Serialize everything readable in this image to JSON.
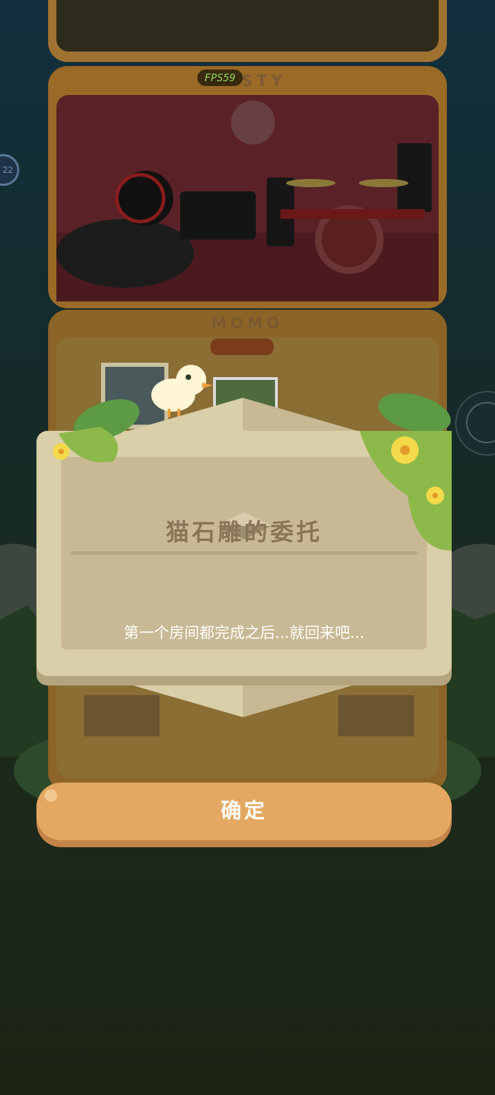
{
  "hud": {
    "fps_label": "FPS59",
    "left_badge": "22"
  },
  "rooms": [
    {
      "name": "DUSTY"
    },
    {
      "name": "MOMO"
    }
  ],
  "dialog": {
    "title": "猫石雕的委托",
    "message": "第一个房间都完成之后...就回来吧...",
    "confirm_label": "确定"
  },
  "colors": {
    "panel": "#d9cfa8",
    "panel_inner": "#c8b994",
    "title_text": "#8a7458",
    "button": "#e4a862",
    "fps_text": "#8fd35a"
  }
}
